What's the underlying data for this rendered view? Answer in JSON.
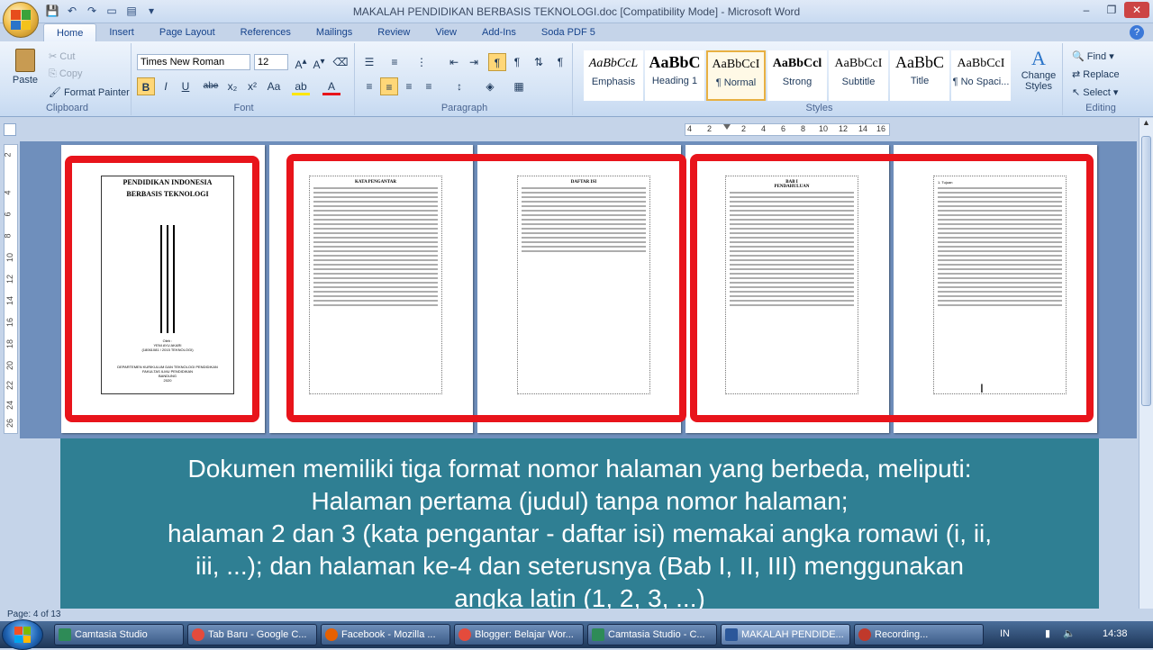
{
  "window": {
    "title": "MAKALAH PENDIDIKAN BERBASIS TEKNOLOGI.doc [Compatibility Mode] - Microsoft Word",
    "controls": [
      "–",
      "❐",
      "✕"
    ]
  },
  "ribbon_tabs": [
    {
      "label": "Home",
      "active": true
    },
    {
      "label": "Insert"
    },
    {
      "label": "Page Layout"
    },
    {
      "label": "References"
    },
    {
      "label": "Mailings"
    },
    {
      "label": "Review"
    },
    {
      "label": "View"
    },
    {
      "label": "Add-Ins"
    },
    {
      "label": "Soda PDF 5"
    }
  ],
  "clipboard": {
    "paste": "Paste",
    "cut": "Cut",
    "copy": "Copy",
    "format_painter": "Format Painter",
    "label": "Clipboard"
  },
  "font": {
    "name": "Times New Roman",
    "size": "12",
    "label": "Font",
    "bold": "B",
    "italic": "I",
    "underline": "U",
    "strike": "abe",
    "subscript": "x₂",
    "superscript": "x²",
    "change_case": "Aa",
    "highlight": "ab",
    "color": "A"
  },
  "paragraph": {
    "label": "Paragraph"
  },
  "styles": {
    "label": "Styles",
    "items": [
      {
        "sample": "AaBbCcL",
        "name": "Emphasis"
      },
      {
        "sample": "AaBbC",
        "name": "Heading 1"
      },
      {
        "sample": "AaBbCcI",
        "name": "¶ Normal",
        "selected": true
      },
      {
        "sample": "AaBbCcl",
        "name": "Strong"
      },
      {
        "sample": "AaBbCcI",
        "name": "Subtitle"
      },
      {
        "sample": "AaBbC",
        "name": "Title"
      },
      {
        "sample": "AaBbCcI",
        "name": "¶ No Spaci..."
      }
    ],
    "change_styles": "Change Styles"
  },
  "editing": {
    "label": "Editing",
    "find": "Find",
    "replace": "Replace",
    "select": "Select"
  },
  "ruler": {
    "h_ticks": [
      "4",
      "2",
      "2",
      "4",
      "6",
      "8",
      "10",
      "12",
      "14",
      "16"
    ],
    "v_ticks": [
      "2",
      "4",
      "6",
      "8",
      "10",
      "12",
      "14",
      "16",
      "18",
      "20",
      "22",
      "24",
      "26"
    ]
  },
  "pages": [
    {
      "title_lines": [
        "PENDIDIKAN INDONESIA",
        "BERBASIS TEKNOLOGI"
      ],
      "footer_lines": [
        "Oleh :",
        "YENI AYU AKARI",
        "(18061081 / 2015 TEKNOLOGI)",
        "DEPARTEMEN KURIKULUM DAN TEKNOLOGI PENDIDIKAN",
        "FAKULTAS ILMU PENDIDIKAN",
        "BANDUNG",
        "2020"
      ]
    },
    {
      "heading": "KATA PENGANTAR"
    },
    {
      "heading": "DAFTAR ISI"
    },
    {
      "heading": "BAB I",
      "subheading": "PENDAHULUAN"
    },
    {
      "heading": "1. Tujuan"
    }
  ],
  "caption": {
    "lines": [
      "Dokumen memiliki tiga format nomor halaman yang berbeda, meliputi:",
      "Halaman pertama (judul) tanpa nomor halaman;",
      "halaman 2 dan 3 (kata pengantar - daftar isi) memakai angka romawi (i, ii,",
      "iii, ...); dan halaman ke-4 dan seterusnya (Bab I, II, III) menggunakan",
      "angka latin (1, 2, 3, ...)"
    ]
  },
  "status": {
    "page": "Page: 4 of 13"
  },
  "taskbar": {
    "items": [
      {
        "label": "Camtasia Studio",
        "color": "#2e8b57"
      },
      {
        "label": "Tab Baru - Google C...",
        "color": "#e44b3c"
      },
      {
        "label": "Facebook - Mozilla ...",
        "color": "#e66000"
      },
      {
        "label": "Blogger: Belajar Wor...",
        "color": "#e44b3c"
      },
      {
        "label": "Camtasia Studio - C...",
        "color": "#2e8b57"
      },
      {
        "label": "MAKALAH PENDIDE...",
        "color": "#2b579a",
        "active": true
      },
      {
        "label": "Recording...",
        "color": "#c0392b"
      }
    ],
    "tray": {
      "lang": "IN",
      "time": "14:38"
    }
  },
  "colors": {
    "highlight_red": "#e8141b",
    "caption_bg": "#2f7f93"
  }
}
